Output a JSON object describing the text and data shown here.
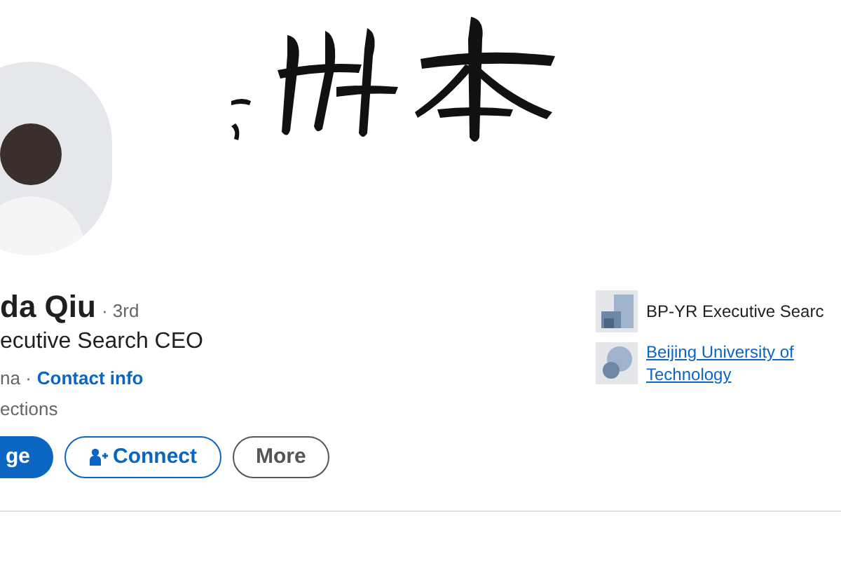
{
  "profile": {
    "name": "da Qiu",
    "degree": "· 3rd",
    "headline": "ecutive Search CEO",
    "location": "na ·",
    "contact_link": "Contact info",
    "connections": "ections"
  },
  "actions": [
    {
      "kind": "primary",
      "label": "ge"
    },
    {
      "kind": "connect",
      "label": "Connect"
    },
    {
      "kind": "outline",
      "label": "More"
    }
  ],
  "experience": [
    {
      "kind": "company",
      "label": "BP-YR Executive Searc",
      "link": false
    },
    {
      "kind": "school",
      "label": "Beijing University of Technology",
      "link": true
    }
  ]
}
